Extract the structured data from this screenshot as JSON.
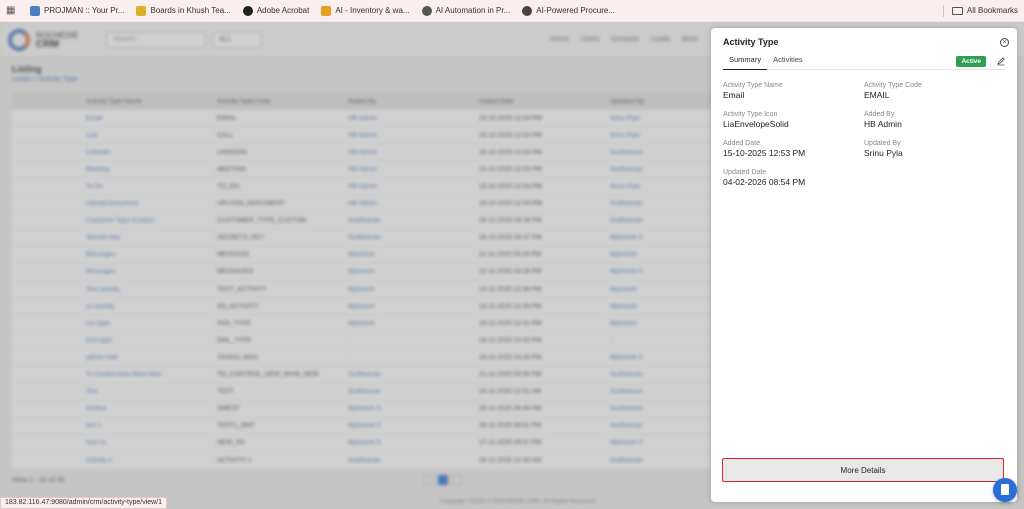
{
  "bookmarks": {
    "items": [
      {
        "label": "PROJMAN :: Your Pr...",
        "color": "#4a7fc1"
      },
      {
        "label": "Boards in Khush Tea...",
        "color": "#d9b02a"
      },
      {
        "label": "Adobe Acrobat",
        "color": "#222222"
      },
      {
        "label": "AI - Inventory & wa...",
        "color": "#e6a023"
      },
      {
        "label": "AI Automation in Pr...",
        "color": "#555555"
      },
      {
        "label": "AI-Powered Procure...",
        "color": "#444444"
      }
    ],
    "all_label": "All Bookmarks"
  },
  "app": {
    "brand_line1": "ROCHEDIE",
    "brand_line2": "CRM",
    "search_placeholder": "Search...",
    "search_scope": "ALL",
    "nav": [
      "Home",
      "Users",
      "Contacts",
      "Leads",
      "More"
    ],
    "page_title": "Listing",
    "breadcrumb": "Leads  >  Activity Type",
    "table": {
      "headers": [
        "Activity Type Name",
        "Activity Type Code",
        "Added By",
        "Added Date",
        "Updated By"
      ],
      "rows": [
        [
          "Email",
          "EMAIL",
          "HB Admin",
          "15-10-2025 12:53 PM",
          "Srinu Pyla"
        ],
        [
          "Call",
          "CALL",
          "HB Admin",
          "15-10-2025 12:53 PM",
          "Srinu Pyla"
        ],
        [
          "LinkedIn",
          "LINKEDIN",
          "HB Admin",
          "15-10-2025 12:53 PM",
          "Sudheesan"
        ],
        [
          "Meeting",
          "MEETING",
          "HB Admin",
          "15-10-2025 12:53 PM",
          "Sudheesan"
        ],
        [
          "To Do",
          "TO_DO",
          "HB Admin",
          "15-10-2025 12:53 PM",
          "Srinu Pyla"
        ],
        [
          "Upload Document",
          "UPLOAD_DOCUMENT",
          "HB Admin",
          "15-10-2025 12:53 PM",
          "Sudheesan"
        ],
        [
          "Customer Type Custom",
          "CUSTOMER_TYPE_CUSTOM",
          "Sudheesan",
          "28-10-2025 08:26 PM",
          "Sudheesan"
        ],
        [
          "Secrets key",
          "SECRETS_KEY",
          "Sudheesan",
          "28-10-2025 08:37 PM",
          "Mytreesh S"
        ],
        [
          "Messages",
          "MESSAGE",
          "Mytreesh",
          "11-11-2025 04:28 PM",
          "Mytreesh"
        ],
        [
          "Messages",
          "MESSAGES",
          "Mytreesh",
          "12-11-2025 04:28 PM",
          "Mytreesh S"
        ],
        [
          "Test activity",
          "TEST_ACTIVITY",
          "Mytreesh",
          "14-11-2025 12:36 PM",
          "Mytreesh"
        ],
        [
          "ss activity",
          "SS_ACTIVITY",
          "Mytreesh",
          "14-11-2025 12:39 PM",
          "Mytreesh"
        ],
        [
          "sss type",
          "SSS_TYPE",
          "Mytreesh",
          "15-11-2025 12:41 PM",
          "Mytreesh"
        ],
        [
          "Dml type",
          "DML_TYPE",
          "-",
          "18-11-2025 03:43 PM",
          "-"
        ],
        [
          "yahoo mail",
          "YAHOO_MAIL",
          "-",
          "19-11-2025 04:16 PM",
          "Mytreesh S"
        ],
        [
          "To Control New Main New",
          "TO_CONTROL_NEW_MAIN_NEW",
          "Sudheesan",
          "21-11-2025 04:56 PM",
          "Sudheesan"
        ],
        [
          "Test",
          "TEST",
          "Sudheesan",
          "24-11-2025 12:51 AM",
          "Sudheesan"
        ],
        [
          "Dmtest",
          "DMEST",
          "Mytreesh S",
          "26-11-2025 06:46 PM",
          "Sudheesan"
        ],
        [
          "test 1",
          "TEST1_DMT",
          "Mytreesh S",
          "26-11-2025 06:51 PM",
          "Sudheesan"
        ],
        [
          "new ss",
          "NEW_SS",
          "Mytreesh S",
          "27-11-2025 09:37 PM",
          "Mytreesh S"
        ],
        [
          "Activity 1",
          "ACTIVITY 1",
          "Sudheesan",
          "28-11-2025 10:49 AM",
          "Sudheesan"
        ]
      ]
    },
    "footer_count": "View 1 - 20 of 39",
    "copyright": "Copyright ©2026 © ROCHEDIE CRM. All Rights Reserved"
  },
  "status_url": "183.82.116.47:9080/admin/crm/activity-type/view/1",
  "drawer": {
    "title": "Activity Type",
    "tabs": [
      "Summary",
      "Activities"
    ],
    "active_tab": "Summary",
    "status_badge": "Active",
    "fields": [
      {
        "label": "Activity Type Name",
        "value": "Email"
      },
      {
        "label": "Activity Type Code",
        "value": "EMAIL"
      },
      {
        "label": "Activity Type Icon",
        "value": "LiaEnvelopeSolid"
      },
      {
        "label": "Added By",
        "value": "HB Admin"
      },
      {
        "label": "Added Date",
        "value": "15-10-2025 12:53 PM"
      },
      {
        "label": "Updated By",
        "value": "Srinu Pyla"
      },
      {
        "label": "Updated Date",
        "value": "04-02-2026 08:54 PM"
      }
    ],
    "more_details_label": "More Details",
    "colors": {
      "badge": "#2e9e52",
      "highlight": "#d9262b",
      "fab": "#2a6fd9"
    }
  }
}
